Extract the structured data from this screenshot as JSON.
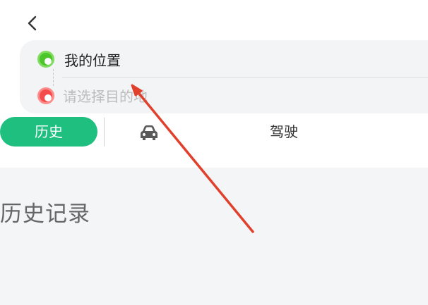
{
  "header": {
    "back_icon": "chevron-left-icon"
  },
  "route": {
    "start_label": "我的位置",
    "destination_placeholder": "请选择目的地",
    "destination_value": "",
    "start_color": "#4bc52a",
    "end_color": "#f44c4c"
  },
  "tabs": {
    "history_label": "历史",
    "car_icon": "car-icon",
    "drive_label": "驾驶",
    "active_color": "#1fbf7f"
  },
  "history": {
    "title": "历史记录"
  },
  "annotation": {
    "arrow_color": "#e0402c"
  }
}
